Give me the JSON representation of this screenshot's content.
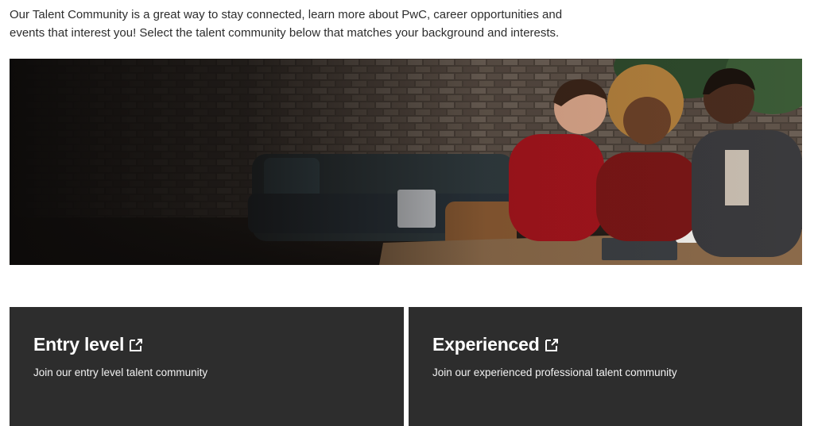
{
  "intro": {
    "line1": "Our Talent Community is a great way to stay connected, learn more about PwC, career opportunities and",
    "line2": "events that interest you! Select the talent community below that matches your background and interests."
  },
  "hero": {
    "alt": "Three colleagues laughing together at a table in an office lounge"
  },
  "cards": [
    {
      "title": "Entry level",
      "description": "Join our entry level talent community",
      "icon": "external-link-icon"
    },
    {
      "title": "Experienced",
      "description": "Join our experienced professional talent community",
      "icon": "external-link-icon"
    }
  ],
  "colors": {
    "card_bg": "#2d2d2d",
    "text": "#2d2d2d",
    "card_text": "#ffffff"
  }
}
